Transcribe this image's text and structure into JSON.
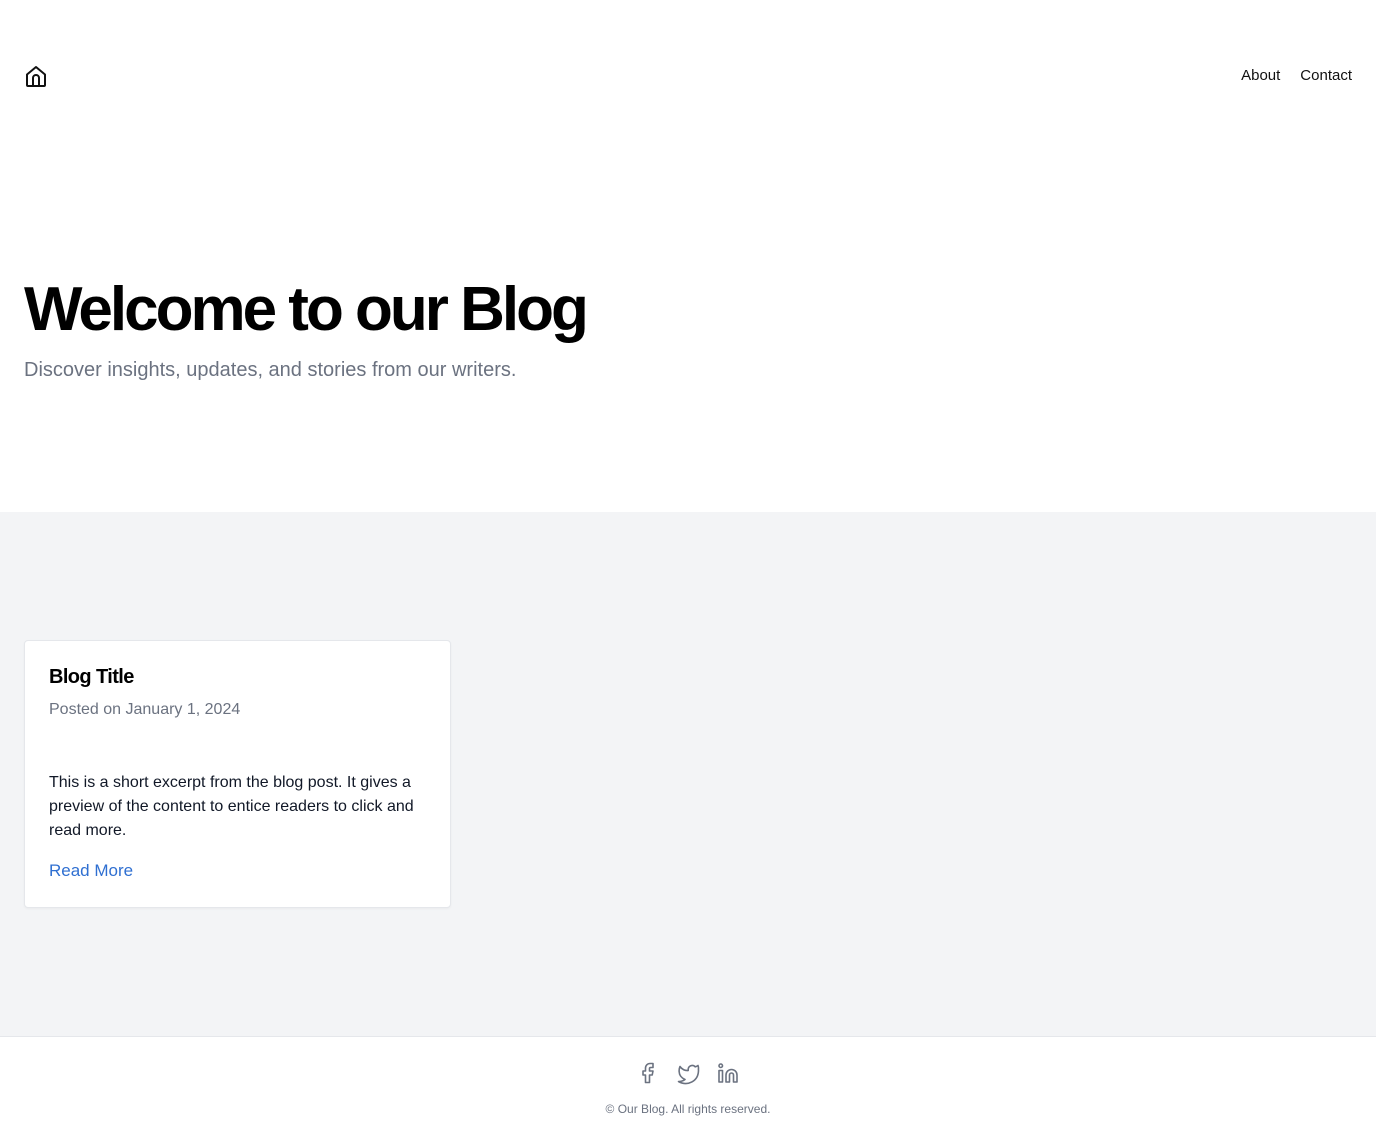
{
  "header": {
    "home_icon": "home-icon",
    "nav": [
      {
        "label": "About"
      },
      {
        "label": "Contact"
      }
    ]
  },
  "hero": {
    "title": "Welcome to our Blog",
    "subtitle": "Discover insights, updates, and stories from our writers."
  },
  "posts": [
    {
      "title": "Blog Title",
      "meta": "Posted on January 1, 2024",
      "excerpt": "This is a short excerpt from the blog post. It gives a preview of the content to entice readers to click and read more.",
      "link_label": "Read More"
    }
  ],
  "footer": {
    "social_icons": [
      "facebook-icon",
      "twitter-icon",
      "linkedin-icon"
    ],
    "copyright": "© Our Blog. All rights reserved."
  },
  "colors": {
    "background": "#ffffff",
    "section_background": "#f3f4f6",
    "muted_text": "#6b7280",
    "link": "#2f6fd1"
  }
}
